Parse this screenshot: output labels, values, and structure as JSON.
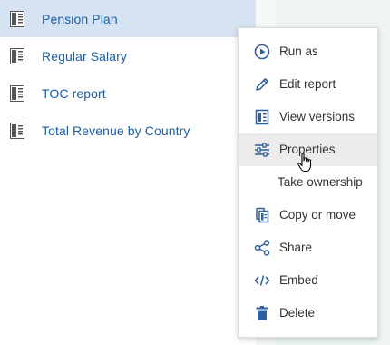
{
  "reports": [
    {
      "label": "Pension Plan",
      "selected": true
    },
    {
      "label": "Regular Salary",
      "selected": false
    },
    {
      "label": "TOC report",
      "selected": false
    },
    {
      "label": "Total Revenue by Country",
      "selected": false
    }
  ],
  "context_menu": {
    "items": [
      {
        "label": "Run as",
        "icon": "play-circle-icon"
      },
      {
        "label": "Edit report",
        "icon": "pencil-icon"
      },
      {
        "label": "View versions",
        "icon": "versions-icon"
      },
      {
        "label": "Properties",
        "icon": "sliders-icon",
        "hovered": true
      },
      {
        "label": "Take ownership",
        "icon": ""
      },
      {
        "label": "Copy or move",
        "icon": "copy-icon"
      },
      {
        "label": "Share",
        "icon": "share-icon"
      },
      {
        "label": "Embed",
        "icon": "code-icon"
      },
      {
        "label": "Delete",
        "icon": "trash-icon"
      }
    ]
  },
  "colors": {
    "accent": "#1a5ea8",
    "selected_row": "#d5e3f2",
    "icon_blue": "#2f5f9e",
    "report_icon": "#555555"
  }
}
